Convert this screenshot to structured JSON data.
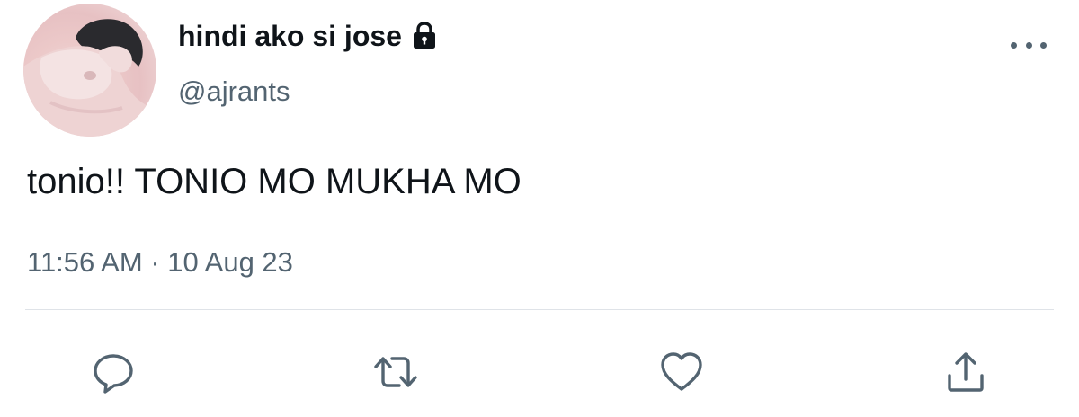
{
  "tweet": {
    "display_name": "hindi ako si jose",
    "handle": "@ajrants",
    "text": "tonio!! TONIO MO MUKHA MO",
    "time": "11:56 AM",
    "separator": "·",
    "date": "10 Aug 23",
    "protected_icon": "lock-icon"
  },
  "actions": {
    "reply_icon": "reply-icon",
    "retweet_icon": "retweet-icon",
    "like_icon": "heart-icon",
    "share_icon": "share-icon",
    "more_icon": "more-horizontal-icon"
  },
  "colors": {
    "text_primary": "#0f1419",
    "text_secondary": "#536471",
    "icon": "#536471",
    "divider": "#dfe3e8"
  }
}
